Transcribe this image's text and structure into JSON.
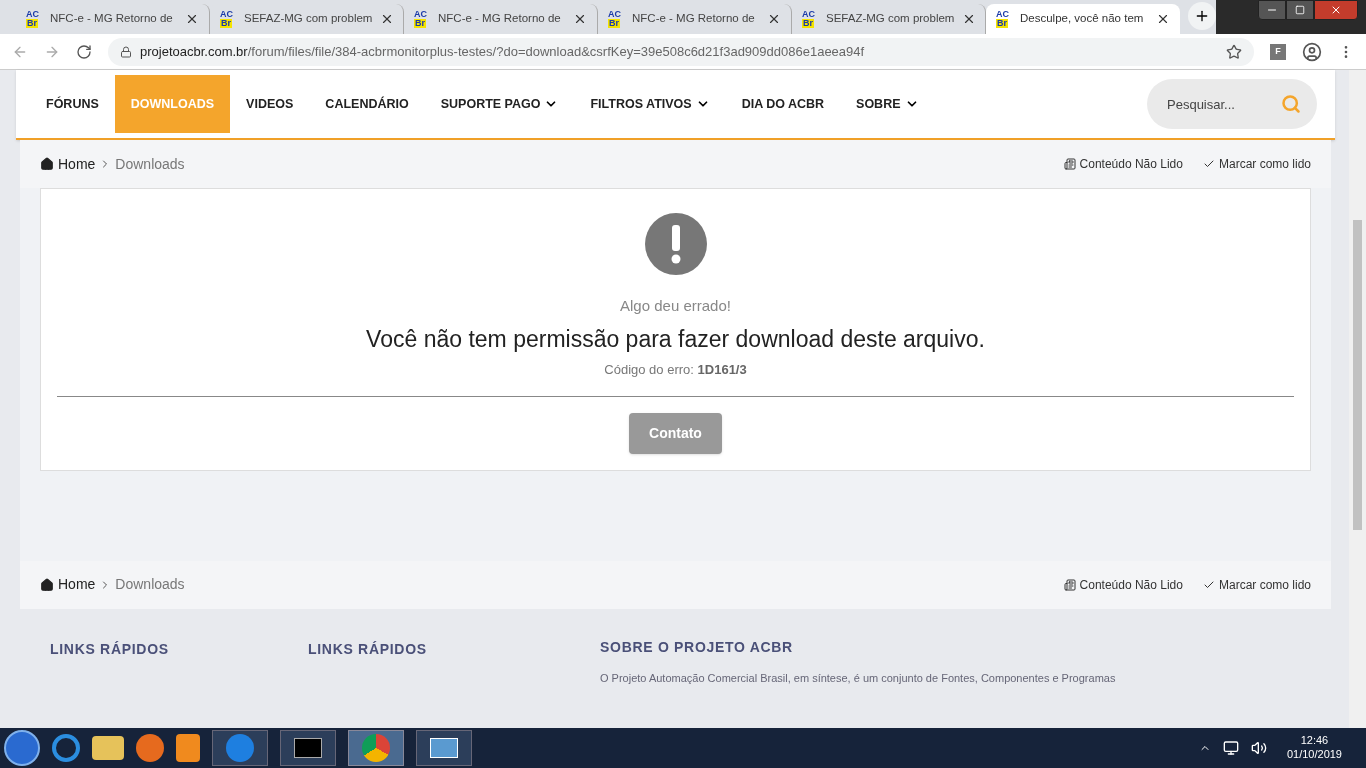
{
  "tabs": [
    {
      "label": "NFC-e - MG Retorno de",
      "icon": [
        "AC",
        "Br"
      ],
      "selected": false
    },
    {
      "label": "SEFAZ-MG com problem",
      "icon": [
        "AC",
        "Br"
      ],
      "selected": false
    },
    {
      "label": "NFC-e - MG Retorno de",
      "icon": [
        "AC",
        "Br"
      ],
      "selected": false
    },
    {
      "label": "NFC-e - MG Retorno de",
      "icon": [
        "AC",
        "Br"
      ],
      "selected": false
    },
    {
      "label": "SEFAZ-MG com problem",
      "icon": [
        "AC",
        "Br"
      ],
      "selected": false
    },
    {
      "label": "Desculpe, você não tem",
      "icon": [
        "AC",
        "Br"
      ],
      "selected": true
    }
  ],
  "address": {
    "host": "projetoacbr.com.br",
    "path": "/forum/files/file/384-acbrmonitorplus-testes/?do=download&csrfKey=39e508c6d21f3ad909dd086e1aeea94f"
  },
  "profile_badge": "F",
  "nav": [
    {
      "label": "FÓRUNS",
      "selected": false,
      "dropdown": false
    },
    {
      "label": "DOWNLOADS",
      "selected": true,
      "dropdown": false
    },
    {
      "label": "VIDEOS",
      "selected": false,
      "dropdown": false
    },
    {
      "label": "CALENDÁRIO",
      "selected": false,
      "dropdown": false
    },
    {
      "label": "SUPORTE PAGO",
      "selected": false,
      "dropdown": true
    },
    {
      "label": "FILTROS ATIVOS",
      "selected": false,
      "dropdown": true
    },
    {
      "label": "DIA DO ACBR",
      "selected": false,
      "dropdown": false
    },
    {
      "label": "SOBRE",
      "selected": false,
      "dropdown": true
    }
  ],
  "search": {
    "placeholder": "Pesquisar..."
  },
  "breadcrumbs": [
    {
      "home": "Home",
      "current": "Downloads",
      "unread": "Conteúdo Não Lido",
      "mark_read": "Marcar como lido"
    },
    {
      "home": "Home",
      "current": "Downloads",
      "unread": "Conteúdo Não Lido",
      "mark_read": "Marcar como lido"
    }
  ],
  "error": {
    "subtitle": "Algo deu errado!",
    "message": "Você não tem permissão para fazer download deste arquivo.",
    "code_label": "Código do erro:",
    "code": "1D161/3",
    "button": "Contato"
  },
  "footer": {
    "columns": [
      "LINKS RÁPIDOS",
      "LINKS RÁPIDOS",
      "SOBRE O PROJETO ACBR"
    ],
    "about": "O Projeto Automação Comercial Brasil, em síntese, é um conjunto de Fontes, Componentes e Programas"
  },
  "taskbar": {
    "time": "12:46",
    "date": "01/10/2019"
  }
}
